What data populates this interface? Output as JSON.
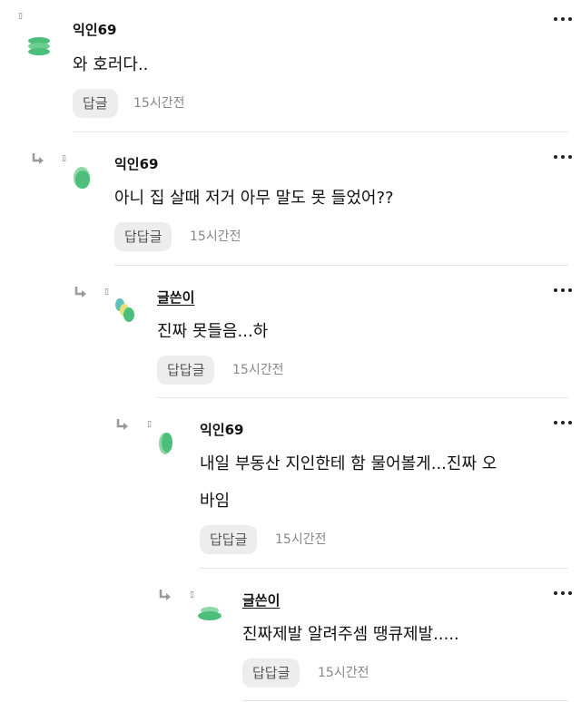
{
  "comments": [
    {
      "author": "익인69",
      "is_writer": false,
      "lines": [
        "와 호러다.."
      ],
      "reply_label": "답글",
      "time": "15시간전"
    },
    {
      "author": "익인69",
      "is_writer": false,
      "lines": [
        "아니 집 살때 저거 아무 말도 못 들었어??"
      ],
      "reply_label": "답답글",
      "time": "15시간전"
    },
    {
      "author": "글쓴이",
      "is_writer": true,
      "lines": [
        "진짜 못들음...하"
      ],
      "reply_label": "답답글",
      "time": "15시간전"
    },
    {
      "author": "익인69",
      "is_writer": false,
      "lines": [
        "내일 부동산 지인한테 함 물어볼게...진짜 오",
        "바임"
      ],
      "reply_label": "답답글",
      "time": "15시간전"
    },
    {
      "author": "글쓴이",
      "is_writer": true,
      "lines": [
        "진짜제발 알려주셈 땡큐제발....."
      ],
      "reply_label": "답답글",
      "time": "15시간전"
    }
  ],
  "colors": {
    "avatar_green": "#4cbf7a",
    "avatar_light_green": "#8fd8a8",
    "avatar_yellow": "#e4e27a",
    "avatar_teal": "#5cc4c0",
    "button_bg": "#ededed"
  },
  "icons": {
    "more": "more-vertical-dots-icon",
    "reply_arrow": "reply-arrow-icon",
    "marker": "small-box-marker"
  }
}
